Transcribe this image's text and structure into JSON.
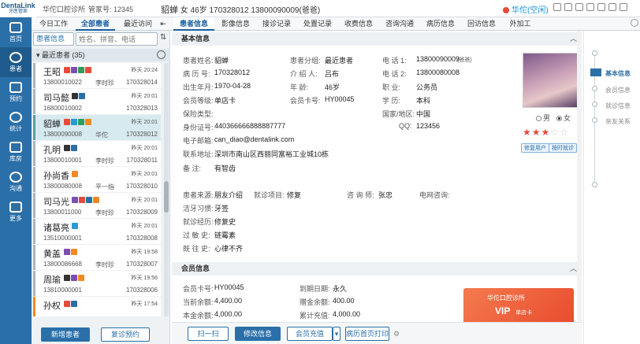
{
  "app": {
    "logo_top": "DentaLink",
    "logo_bottom": "牙医管家",
    "clinic": "华佗口腔诊所",
    "account": "管家号: 12345"
  },
  "header_patient": {
    "name": "貂蝉",
    "gender": "女",
    "age": "46岁",
    "id": "170328012",
    "phone": "13800090009(爸爸)"
  },
  "status": {
    "label": "华佗(空闲)",
    "color": "#e64a3b"
  },
  "nav": [
    {
      "label": "首页",
      "icon": "home-icon"
    },
    {
      "label": "患者",
      "icon": "patient-icon",
      "active": true
    },
    {
      "label": "预约",
      "icon": "calendar-icon"
    },
    {
      "label": "统计",
      "icon": "chart-icon"
    },
    {
      "label": "库房",
      "icon": "warehouse-icon"
    },
    {
      "label": "沟通",
      "icon": "play-icon"
    },
    {
      "label": "更多",
      "icon": "grid-icon"
    }
  ],
  "left_tabs": [
    "今日工作",
    "全部患者",
    "最近访问"
  ],
  "search": {
    "select": "患者信息",
    "placeholder": "姓名、拼音、电话"
  },
  "group": {
    "label": "最近患者 (35)"
  },
  "patients": [
    {
      "name": "王昭",
      "time": "昨天 20:24",
      "phone": "13800010022",
      "doctor": "李时珍",
      "num": "170328014"
    },
    {
      "name": "司马懿",
      "time": "昨天 20:01",
      "phone": "16800010002",
      "doctor": "",
      "num": "170328013"
    },
    {
      "name": "貂蝉",
      "time": "昨天 20:01",
      "phone": "13800090008",
      "doctor": "华佗",
      "num": "170328012"
    },
    {
      "name": "孔明",
      "time": "昨天 20:01",
      "phone": "13800010001",
      "doctor": "李时珍",
      "num": "170328011"
    },
    {
      "name": "孙尚香",
      "time": "昨天 20:01",
      "phone": "13800080008",
      "doctor": "平一指",
      "num": "170328010"
    },
    {
      "name": "司马光",
      "time": "昨天 20:01",
      "phone": "13800011000",
      "doctor": "李时珍",
      "num": "170328009"
    },
    {
      "name": "诸葛亮",
      "time": "昨天 20:01",
      "phone": "13510000001",
      "doctor": "",
      "num": "170328008"
    },
    {
      "name": "黄盖",
      "time": "昨天 19:58",
      "phone": "13800086668",
      "doctor": "李时珍",
      "num": "170328007"
    },
    {
      "name": "周瑜",
      "time": "昨天 19:56",
      "phone": "13810000001",
      "doctor": "",
      "num": "170328006"
    },
    {
      "name": "孙权",
      "time": "昨天 17:54",
      "phone": "",
      "doctor": "",
      "num": ""
    }
  ],
  "left_buttons": {
    "new": "新增患者",
    "revisit": "复诊预约"
  },
  "right_tabs": [
    "患者信息",
    "影像信息",
    "接诊记录",
    "处置记录",
    "收费信息",
    "咨询沟通",
    "病历信息",
    "回访信息",
    "外加工"
  ],
  "basic": {
    "title": "基本信息",
    "name_l": "患者姓名:",
    "name_v": "貂蝉",
    "group_l": "患者分组:",
    "group_v": "最近患者",
    "phone1_l": "电    话 1:",
    "phone1_v": "13800090009",
    "phone1_note": "(爸爸)",
    "record_l": "病 历 号:",
    "record_v": "170328012",
    "intro_l": "介 绍 人:",
    "intro_v": "吕布",
    "phone2_l": "电    话 2:",
    "phone2_v": "13800080008",
    "birth_l": "出生年月:",
    "birth_v": "1970-04-28",
    "age_l": "年      龄:",
    "age_v": "46岁",
    "job_l": "职      业:",
    "job_v": "公务员",
    "level_l": "会员等级:",
    "level_v": "单店卡",
    "card_l": "会员卡号:",
    "card_v": "HY00045",
    "edu_l": "学      历:",
    "edu_v": "本科",
    "ins_l": "保险类型:",
    "ins_v": "",
    "nation_l": "国家/地区:",
    "nation_v": "中国",
    "idno_l": "身份证号:",
    "idno_v": "440366666888887777",
    "qq_l": "QQ:",
    "qq_v": "123456",
    "email_l": "电子邮箱:",
    "email_v": "can_diao@dentalink.com",
    "addr_l": "联系地址:",
    "addr_v": "深圳市南山区西丽同富裕工业城10栋",
    "note_l": "备      注:",
    "note_v": "有智齿",
    "gender_male": "男",
    "gender_female": "女",
    "badge1": "修复用户",
    "badge2": "按时就诊",
    "rating": 3,
    "source_l": "患者来源:",
    "source_v": "朋友介绍",
    "visit_l": "就诊项目:",
    "visit_v": "修复",
    "consult_l": "咨 询 师:",
    "consult_v": "张忠",
    "online_l": "电网咨询:",
    "online_v": "",
    "clean_l": "洁牙习惯:",
    "clean_v": "牙签",
    "exp_l": "就诊经历:",
    "exp_v": "修复史",
    "allergy_l": "过 敏 史:",
    "allergy_v": "链霉素",
    "history_l": "既 往 史:",
    "history_v": "心律不齐"
  },
  "member": {
    "title": "会员信息",
    "card_l": "会员卡号:",
    "card_v": "HY00045",
    "expire_l": "到期日期:",
    "expire_v": "永久",
    "bal_l": "当前余额:",
    "bal_v": "4,400.00",
    "gift_l": "赠金余额:",
    "gift_v": "400.00",
    "base_l": "本金余额:",
    "base_v": "4,000.00",
    "total_l": "累计充值:",
    "total_v": "4,000.00",
    "vip_clinic": "华佗口腔诊所",
    "vip_text": "VIP",
    "vip_sub": "单店卡"
  },
  "actions": {
    "scan": "扫一扫",
    "edit": "修改信息",
    "recharge": "会员充值",
    "print": "病历首页打印"
  },
  "right_nav": [
    "基本信息",
    "会员信息",
    "就诊信息",
    "亲友关系"
  ]
}
